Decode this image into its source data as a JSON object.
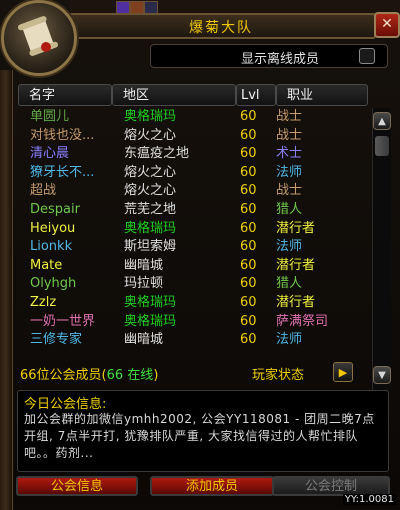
{
  "window": {
    "title": "爆菊大队",
    "close_label": "✕"
  },
  "offline_toggle": {
    "label": "显示离线成员",
    "checked": false
  },
  "columns": {
    "name": "名字",
    "zone": "地区",
    "level": "Lvl",
    "class": "职业"
  },
  "members": [
    {
      "name": "单圆儿",
      "name_color": "#5fa843",
      "zone": "奥格瑞玛",
      "zone_color": "#1fd01f",
      "level": "60",
      "class": "战士",
      "class_color": "#c69b6d"
    },
    {
      "name": "对钱也没...",
      "name_color": "#c69b6d",
      "zone": "熔火之心",
      "zone_color": "#e0e0e0",
      "level": "60",
      "class": "战士",
      "class_color": "#c69b6d"
    },
    {
      "name": "清心晨",
      "name_color": "#8a7fff",
      "zone": "东瘟疫之地",
      "zone_color": "#e0e0e0",
      "level": "60",
      "class": "术士",
      "class_color": "#8a7fff"
    },
    {
      "name": "獠牙长不...",
      "name_color": "#4fb8e8",
      "zone": "熔火之心",
      "zone_color": "#e0e0e0",
      "level": "60",
      "class": "法师",
      "class_color": "#4fb8e8"
    },
    {
      "name": "超战",
      "name_color": "#c69b6d",
      "zone": "熔火之心",
      "zone_color": "#e0e0e0",
      "level": "60",
      "class": "战士",
      "class_color": "#c69b6d"
    },
    {
      "name": "Despair",
      "name_color": "#6ec84a",
      "zone": "荒芜之地",
      "zone_color": "#e0e0e0",
      "level": "60",
      "class": "猎人",
      "class_color": "#6ec84a"
    },
    {
      "name": "Heiyou",
      "name_color": "#f0f040",
      "zone": "奥格瑞玛",
      "zone_color": "#1fd01f",
      "level": "60",
      "class": "潜行者",
      "class_color": "#f0f040"
    },
    {
      "name": "Lionkk",
      "name_color": "#4fb8e8",
      "zone": "斯坦索姆",
      "zone_color": "#e0e0e0",
      "level": "60",
      "class": "法师",
      "class_color": "#4fb8e8"
    },
    {
      "name": "Mate",
      "name_color": "#f0f040",
      "zone": "幽暗城",
      "zone_color": "#e0e0e0",
      "level": "60",
      "class": "潜行者",
      "class_color": "#f0f040"
    },
    {
      "name": "Olyhgh",
      "name_color": "#6ec84a",
      "zone": "玛拉顿",
      "zone_color": "#e0e0e0",
      "level": "60",
      "class": "猎人",
      "class_color": "#6ec84a"
    },
    {
      "name": "Zzlz",
      "name_color": "#f0f040",
      "zone": "奥格瑞玛",
      "zone_color": "#1fd01f",
      "level": "60",
      "class": "潜行者",
      "class_color": "#f0f040"
    },
    {
      "name": "一奶一世界",
      "name_color": "#e070b0",
      "zone": "奥格瑞玛",
      "zone_color": "#1fd01f",
      "level": "60",
      "class": "萨满祭司",
      "class_color": "#e070b0"
    },
    {
      "name": "三修专家",
      "name_color": "#4fb8e8",
      "zone": "幽暗城",
      "zone_color": "#e0e0e0",
      "level": "60",
      "class": "法师",
      "class_color": "#4fb8e8"
    }
  ],
  "summary": {
    "count_prefix": "66位公会成员(",
    "online": "66 在线",
    "count_suffix": ")",
    "player_status": "玩家状态"
  },
  "motd": {
    "title": "今日公会信息:",
    "text": "加公会群的加微信ymhh2002, 公会YY118081 - 团周二晚7点开组, 7点半开打, 犹豫排队严重, 大家找信得过的人帮忙排队吧。。药剂..."
  },
  "buttons": {
    "guild_info": "公会信息",
    "add_member": "添加成员",
    "guild_control": "公会控制"
  },
  "version": "YY:1.0081"
}
